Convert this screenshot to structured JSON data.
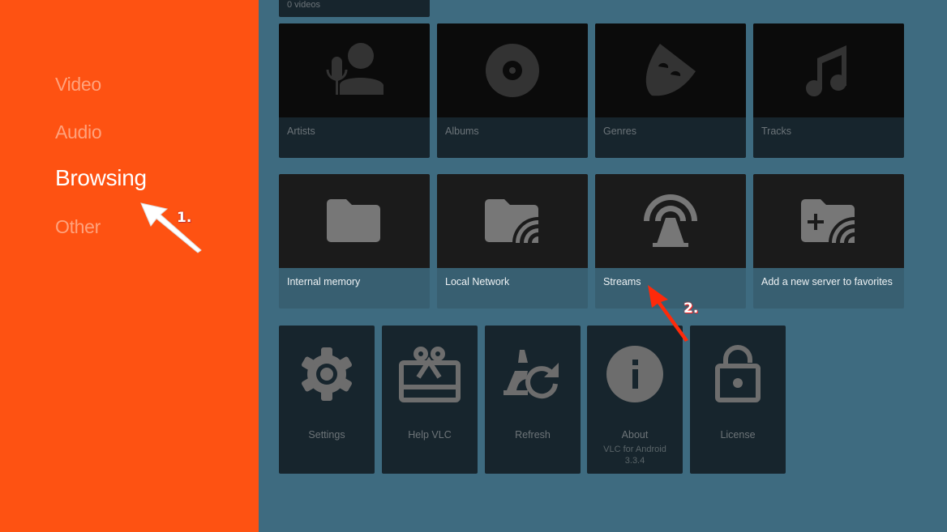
{
  "sidebar": {
    "items": [
      {
        "label": "Video",
        "active": false
      },
      {
        "label": "Audio",
        "active": false
      },
      {
        "label": "Browsing",
        "active": true
      },
      {
        "label": "Other",
        "active": false
      }
    ]
  },
  "video_section": {
    "count_label": "0 videos"
  },
  "audio_section": {
    "cards": [
      {
        "label": "Artists",
        "icon": "artist-icon"
      },
      {
        "label": "Albums",
        "icon": "album-icon"
      },
      {
        "label": "Genres",
        "icon": "genre-mask-icon"
      },
      {
        "label": "Tracks",
        "icon": "music-note-icon"
      }
    ]
  },
  "browsing_section": {
    "cards": [
      {
        "label": "Internal memory",
        "icon": "folder-icon"
      },
      {
        "label": "Local Network",
        "icon": "network-folder-icon"
      },
      {
        "label": "Streams",
        "icon": "stream-antenna-icon"
      },
      {
        "label": "Add a new server to favorites",
        "icon": "add-network-folder-icon"
      }
    ]
  },
  "other_section": {
    "cards": [
      {
        "label": "Settings",
        "icon": "gear-icon"
      },
      {
        "label": "Help VLC",
        "icon": "gift-icon"
      },
      {
        "label": "Refresh",
        "icon": "vlc-refresh-icon"
      },
      {
        "label": "About",
        "sub1": "VLC for Android",
        "sub2": "3.3.4",
        "icon": "info-icon"
      },
      {
        "label": "License",
        "icon": "unlock-icon"
      }
    ]
  },
  "annotations": {
    "step1": "1.",
    "step2": "2."
  },
  "colors": {
    "sidebar_bg": "#fe5212",
    "main_bg": "#3e6b80",
    "arrow_step2": "#fe2a0a"
  }
}
